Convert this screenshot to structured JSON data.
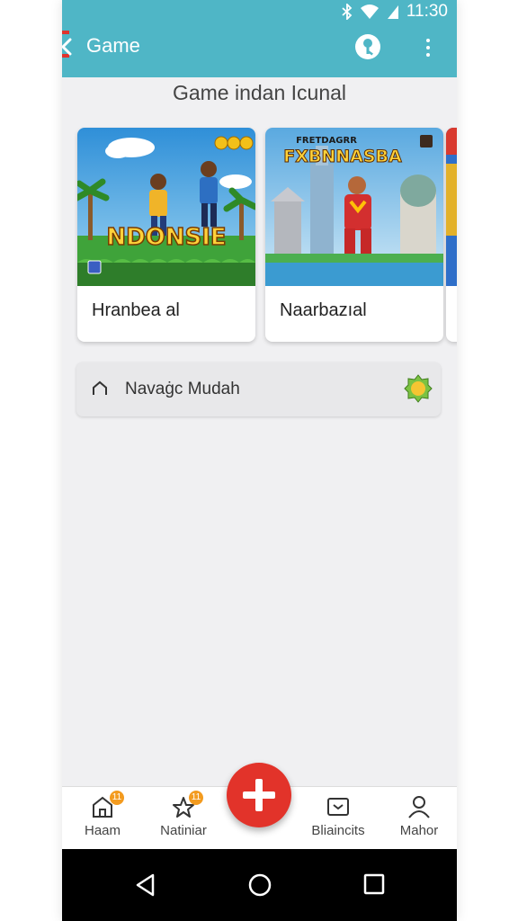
{
  "status_bar": {
    "time": "11:30",
    "icons": [
      "bluetooth-icon",
      "wifi-icon",
      "signal-icon"
    ]
  },
  "app_bar": {
    "title": "Game",
    "color": "#4fb6c6",
    "actions": [
      "key-icon",
      "more-vert-icon"
    ]
  },
  "section": {
    "title": "Game indan Icunal"
  },
  "cards": [
    {
      "label": "Hranbea al",
      "art_title": "NDONSIE",
      "art_badge": "SIF"
    },
    {
      "label": "Naarbazıal",
      "art_title": "FXBNNASBA",
      "art_subtitle": "FRETDAGRR"
    }
  ],
  "list_row": {
    "text": "Navaġc Mudah",
    "icon": "home-outline-icon",
    "badge_icon": "star-badge-icon"
  },
  "bottom_nav": {
    "items": [
      {
        "label": "Haam",
        "icon": "home-icon",
        "badge": "11"
      },
      {
        "label": "Natiniar",
        "icon": "star-icon",
        "badge": "11"
      },
      {
        "label": "Bliaincits",
        "icon": "inbox-icon"
      },
      {
        "label": "Mahor",
        "icon": "person-icon"
      }
    ],
    "fab_icon": "plus-icon",
    "fab_color": "#e2332a"
  },
  "system_nav": [
    "back-triangle-icon",
    "home-circle-icon",
    "recents-square-icon"
  ]
}
